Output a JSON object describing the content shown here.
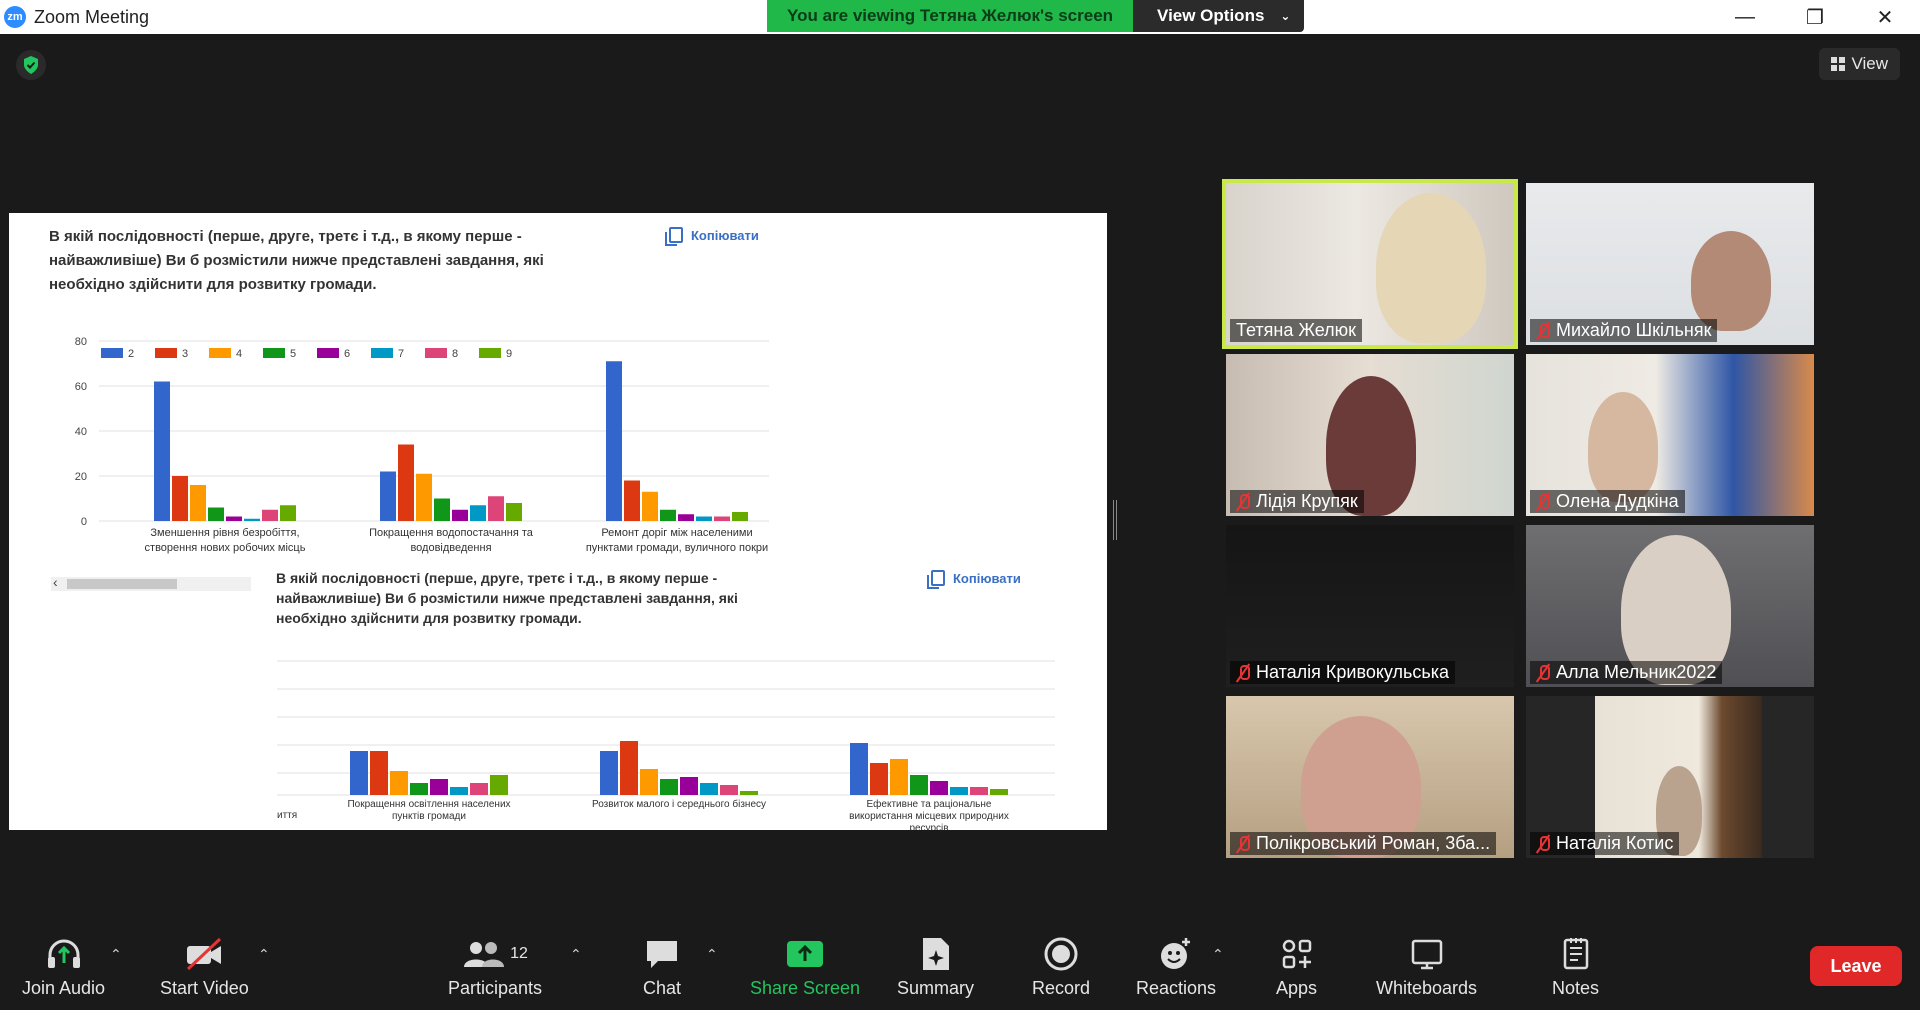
{
  "window": {
    "app_logo": "zm",
    "title": "Zoom Meeting",
    "viewing_banner": "You are viewing Тетяна Желюк's screen",
    "view_options_label": "View Options",
    "controls": [
      "minimize",
      "restore",
      "close"
    ]
  },
  "top_right": {
    "view_label": "View"
  },
  "shared_screen": {
    "question_text_1": [
      "В якій послідовності (перше, друге, третє і т.д., в якому перше -",
      " найважливіше)  Ви б розмістили нижче представлені завдання, які",
      "необхідно здійснити для розвитку громади."
    ],
    "question_text_2": [
      "В якій послідовності (перше, друге, третє і т.д., в якому перше -",
      " найважливіше)  Ви б розмістили нижче представлені завдання, які",
      "необхідно здійснити для розвитку громади."
    ],
    "copy_label": "Копіювати",
    "trailing_label": "иття"
  },
  "chart_data": [
    {
      "type": "bar",
      "legend": [
        "2",
        "3",
        "4",
        "5",
        "6",
        "7",
        "8",
        "9"
      ],
      "colors": [
        "#3366cc",
        "#dc3912",
        "#ff9900",
        "#109618",
        "#990099",
        "#0099c6",
        "#dd4477",
        "#66aa00"
      ],
      "yticks": [
        "80",
        "60",
        "40",
        "20",
        "0"
      ],
      "ylim": [
        0,
        80
      ],
      "categories": [
        [
          "Зменшення рівня безробіття,",
          "створення нових робочих місць"
        ],
        [
          "Покращення водопостачання та",
          "водовідведення"
        ],
        [
          "Ремонт доріг між населеними",
          "пунктами громади, вуличного покри"
        ]
      ],
      "series_values": [
        [
          62,
          20,
          16,
          6,
          2,
          1,
          5,
          7
        ],
        [
          22,
          34,
          21,
          10,
          5,
          7,
          11,
          8
        ],
        [
          71,
          18,
          13,
          5,
          3,
          2,
          2,
          4
        ]
      ]
    },
    {
      "type": "bar",
      "legend": [
        "2",
        "3",
        "4",
        "5",
        "6",
        "7",
        "8",
        "9"
      ],
      "colors": [
        "#3366cc",
        "#dc3912",
        "#ff9900",
        "#109618",
        "#990099",
        "#0099c6",
        "#dd4477",
        "#66aa00"
      ],
      "categories": [
        [
          "Покращення освітлення населених",
          "пунктів громади"
        ],
        [
          "Розвиток малого і середнього бізнесу",
          ""
        ],
        [
          "Ефективне та раціональне",
          "використання місцевих природних",
          "ресурсів"
        ]
      ],
      "series_values": [
        [
          22,
          22,
          12,
          6,
          8,
          4,
          6,
          10
        ],
        [
          22,
          27,
          13,
          8,
          9,
          6,
          5,
          2
        ],
        [
          26,
          16,
          18,
          10,
          7,
          4,
          4,
          3
        ]
      ]
    }
  ],
  "participants": [
    {
      "name": "Тетяна Желюк",
      "muted": false,
      "active": true
    },
    {
      "name": "Михайло Шкільняк",
      "muted": true,
      "active": false
    },
    {
      "name": "Лідія Крупяк",
      "muted": true,
      "active": false
    },
    {
      "name": "Олена Дудкіна",
      "muted": true,
      "active": false
    },
    {
      "name": "Наталія Кривокульська",
      "muted": true,
      "active": false
    },
    {
      "name": "Алла Мельник2022",
      "muted": true,
      "active": false
    },
    {
      "name": "Полікровський Роман, 3ба...",
      "muted": true,
      "active": false
    },
    {
      "name": "Наталія Котис",
      "muted": true,
      "active": false
    }
  ],
  "toolbar": {
    "join_audio": "Join Audio",
    "start_video": "Start Video",
    "participants": "Participants",
    "participants_count": "12",
    "chat": "Chat",
    "share_screen": "Share Screen",
    "summary": "Summary",
    "record": "Record",
    "reactions": "Reactions",
    "apps": "Apps",
    "whiteboards": "Whiteboards",
    "notes": "Notes",
    "leave": "Leave"
  },
  "colors": {
    "accent_green": "#22c55e",
    "leave_red": "#e02828",
    "active_speaker": "#c9e84a",
    "brand_blue": "#2d8cff"
  }
}
